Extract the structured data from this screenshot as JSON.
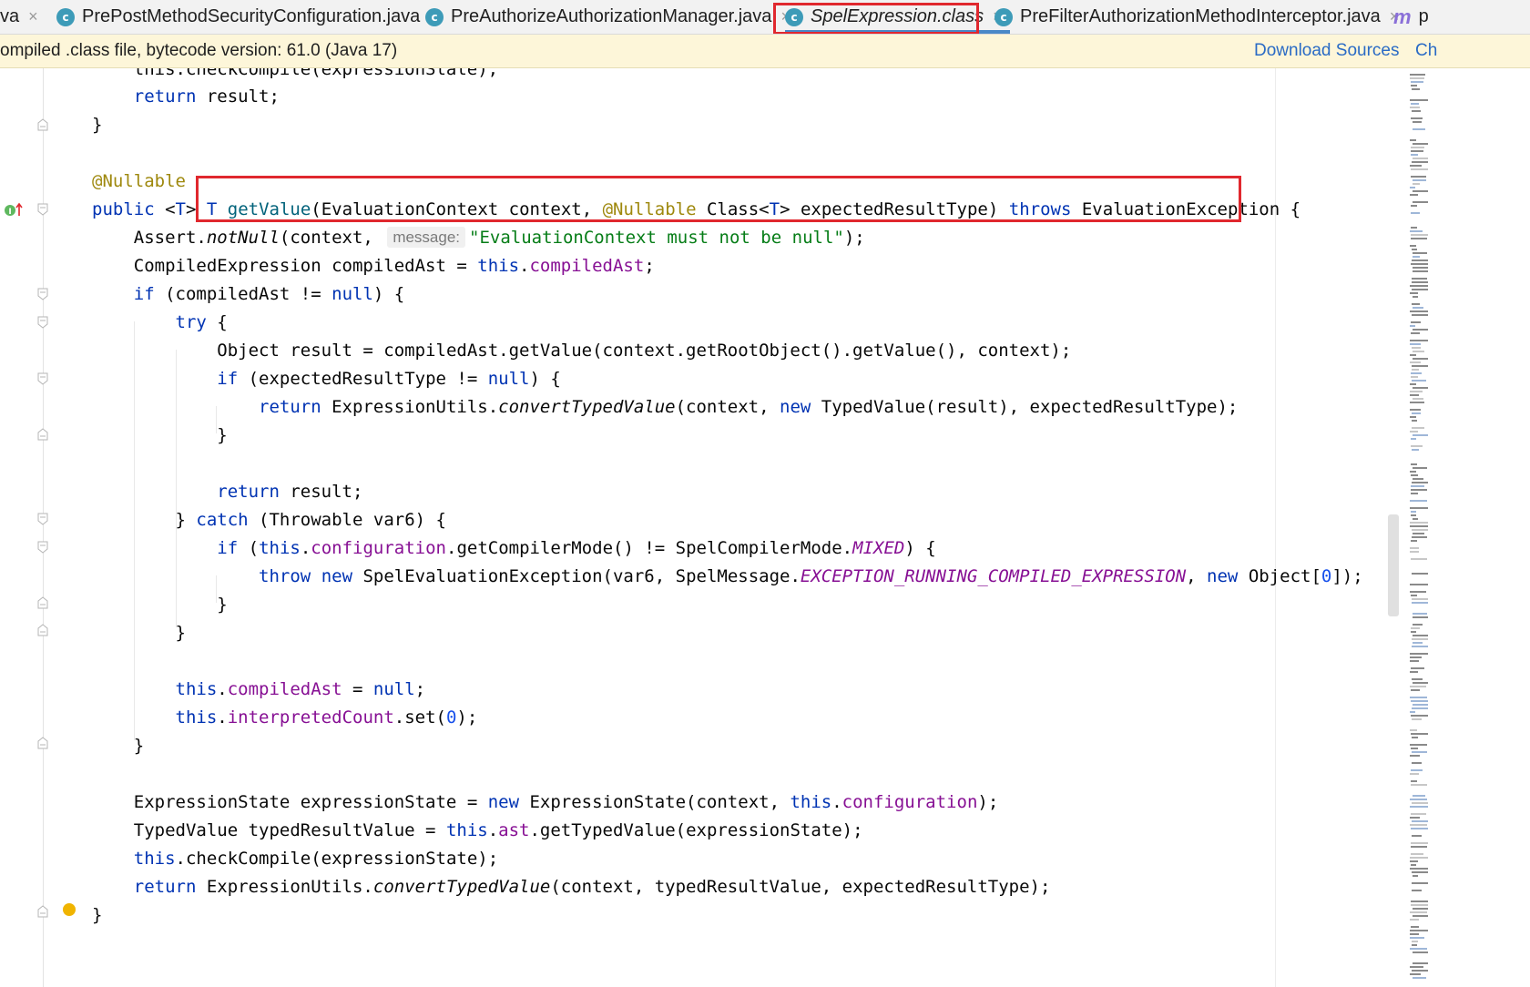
{
  "tabs": [
    {
      "label": "va",
      "icon": "none",
      "active": false
    },
    {
      "label": "PrePostMethodSecurityConfiguration.java",
      "icon": "class-icon",
      "active": false
    },
    {
      "label": "PreAuthorizeAuthorizationManager.java",
      "icon": "class-icon",
      "active": false
    },
    {
      "label": "SpelExpression.class",
      "icon": "class-icon",
      "active": true
    },
    {
      "label": "PreFilterAuthorizationMethodInterceptor.java",
      "icon": "class-icon",
      "active": false
    },
    {
      "label": "p",
      "icon": "method-icon",
      "active": false
    }
  ],
  "tab_icon_letter": "c",
  "method_icon_letter": "m",
  "close_glyph": "×",
  "banner": {
    "message": "ompiled .class file, bytecode version: 61.0 (Java 17)",
    "download_sources": "Download Sources",
    "choose_sources": "Ch"
  },
  "code": {
    "l00": "    this.checkCompile(expressionState);",
    "l01_kw": "return",
    "l01_rest": " result;",
    "l02": "}",
    "l04_ann": "@Nullable",
    "l05": {
      "kw1": "public",
      "t1": " <",
      "tp1": "T",
      "t2": "> ",
      "tp2": "T",
      "t3": " ",
      "name": "getValue",
      "t4": "(EvaluationContext context, ",
      "ann": "@Nullable",
      "t5": " Class<",
      "tp3": "T",
      "t6": "> expectedResultType) ",
      "kw2": "throws",
      "t7": " EvaluationException {"
    },
    "l06": {
      "a": "Assert.",
      "b": "notNull",
      "c": "(context, ",
      "hint": "message:",
      "str": "\"EvaluationContext must not be null\"",
      "d": ");"
    },
    "l07": {
      "a": "CompiledExpression compiledAst = ",
      "kw": "this",
      "b": ".",
      "fld": "compiledAst",
      "c": ";"
    },
    "l08": {
      "kw": "if",
      "a": " (compiledAst != ",
      "kw2": "null",
      "b": ") {"
    },
    "l09": {
      "kw": "try",
      "a": " {"
    },
    "l10": "Object result = compiledAst.getValue(context.getRootObject().getValue(), context);",
    "l11": {
      "kw": "if",
      "a": " (expectedResultType != ",
      "kw2": "null",
      "b": ") {"
    },
    "l12": {
      "kw": "return",
      "a": " ExpressionUtils.",
      "b": "convertTypedValue",
      "c": "(context, ",
      "kw2": "new",
      "d": " TypedValue(result), expectedResultType);"
    },
    "l13": "}",
    "l15": {
      "kw": "return",
      "a": " result;"
    },
    "l16": {
      "a": "} ",
      "kw": "catch",
      "b": " (Throwable var6) {"
    },
    "l17": {
      "kw": "if",
      "a": " (",
      "kw2": "this",
      "b": ".",
      "fld": "configuration",
      "c": ".getCompilerMode() != SpelCompilerMode.",
      "cst": "MIXED",
      "d": ") {"
    },
    "l18": {
      "kw": "throw",
      "a": " ",
      "kw2": "new",
      "b": " SpelEvaluationException(var6, SpelMessage.",
      "cst": "EXCEPTION_RUNNING_COMPILED_EXPRESSION",
      "c": ", ",
      "kw3": "new",
      "d": " Object[",
      "num": "0",
      "e": "]);"
    },
    "l19": "}",
    "l20": "}",
    "l22": {
      "kw": "this",
      "a": ".",
      "fld": "compiledAst",
      "b": " = ",
      "kw2": "null",
      "c": ";"
    },
    "l23": {
      "kw": "this",
      "a": ".",
      "fld": "interpretedCount",
      "b": ".set(",
      "num": "0",
      "c": ");"
    },
    "l24": "}",
    "l26": {
      "a": "ExpressionState expressionState = ",
      "kw": "new",
      "b": " ExpressionState(context, ",
      "kw2": "this",
      "c": ".",
      "fld": "configuration",
      "d": ");"
    },
    "l27": {
      "a": "TypedValue typedResultValue = ",
      "kw": "this",
      "b": ".",
      "fld": "ast",
      "c": ".getTypedValue(expressionState);"
    },
    "l28": {
      "kw": "this",
      "a": ".checkCompile(expressionState);"
    },
    "l29": {
      "kw": "return",
      "a": " ExpressionUtils.",
      "b": "convertTypedValue",
      "c": "(context, typedResultValue, expectedResultType);"
    },
    "l30": "}"
  },
  "colors": {
    "keyword": "#0033b3",
    "annotation": "#9e880d",
    "field": "#871094",
    "string": "#067d17",
    "number": "#1750eb",
    "highlight": "#e0282e",
    "banner_bg": "#fdf6d9",
    "link": "#2a6bc5"
  }
}
